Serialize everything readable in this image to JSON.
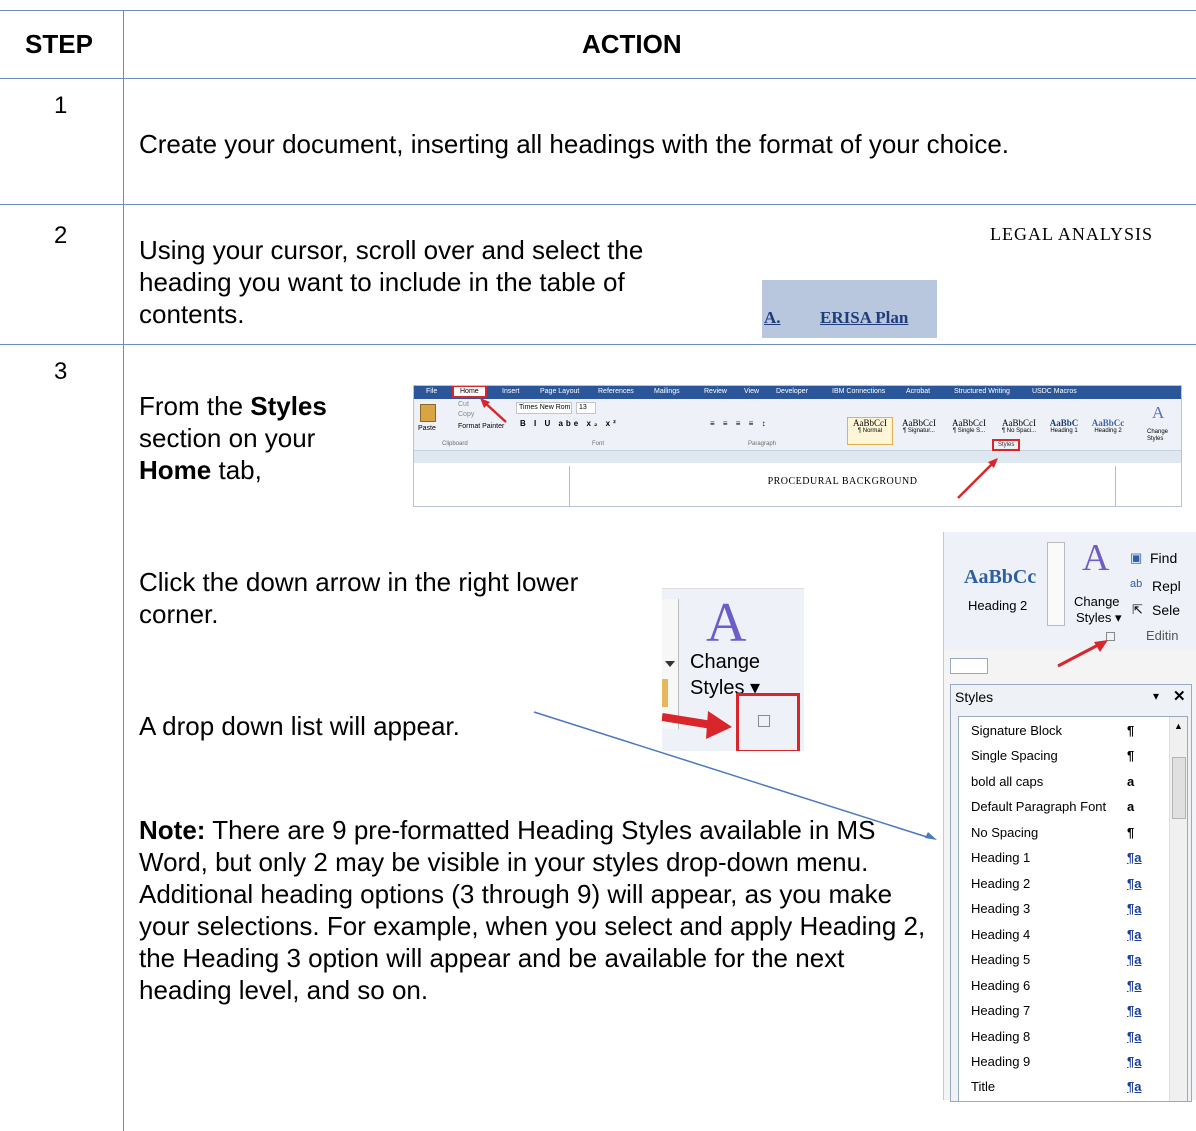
{
  "table": {
    "header_step": "STEP",
    "header_action": "ACTION",
    "row1": {
      "step": "1",
      "text": "Create your document, inserting all headings with the format of your choice."
    },
    "row2": {
      "step": "2",
      "text": "Using your cursor, scroll over and select the heading you want to include in the table of contents.",
      "sample_heading": "LEGAL ANALYSIS",
      "sample_label": "A.",
      "sample_title": "ERISA Plan"
    },
    "row3": {
      "step": "3",
      "from_the": "From the ",
      "styles_word": "Styles",
      "section_on": " section on your ",
      "home_word": "Home",
      "tab_text": " tab,",
      "click_text": "Click the down arrow in the right lower corner.",
      "dropdown_text": "A drop down list will appear.",
      "note_label": "Note:",
      "note_text": "  There are 9 pre-formatted Heading Styles available in MS Word, but only 2 may be visible in your styles drop-down menu.  Additional heading options (3 through 9) will appear, as you make your selections.  For example, when you select and apply Heading 2, the Heading 3 option will appear and be available for the next heading level, and so on."
    }
  },
  "ribbon": {
    "tabs": [
      "File",
      "Home",
      "Insert",
      "Page Layout",
      "References",
      "Mailings",
      "Review",
      "View",
      "Developer",
      "IBM Connections",
      "Acrobat",
      "Structured Writing",
      "USDC Macros"
    ],
    "clipboard": {
      "paste": "Paste",
      "cut": "Cut",
      "copy": "Copy",
      "format_painter": "Format Painter",
      "group": "Clipboard"
    },
    "font": {
      "name": "Times New Rom",
      "size": "13",
      "group": "Font"
    },
    "paragraph_group": "Paragraph",
    "styles_group": "Styles",
    "style_samples": [
      {
        "sample": "AaBbCcI",
        "name": "¶ Normal"
      },
      {
        "sample": "AaBbCcI",
        "name": "¶ Signatur..."
      },
      {
        "sample": "AaBbCcI",
        "name": "¶ Single S..."
      },
      {
        "sample": "AaBbCcI",
        "name": "¶ No Spaci..."
      },
      {
        "sample": "AaBbC",
        "name": "Heading 1"
      },
      {
        "sample": "AaBbCc",
        "name": "Heading 2"
      }
    ],
    "change_styles": "Change Styles",
    "document_text": "PROCEDURAL BACKGROUND"
  },
  "zoom": {
    "change": "Change",
    "styles": "Styles"
  },
  "pane": {
    "heading2_sample": "AaBbCc",
    "heading2_label": "Heading 2",
    "change": "Change",
    "styles": "Styles",
    "find": "Find",
    "replace": "Repl",
    "select": "Sele",
    "editing": "Editin",
    "panel_title": "Styles",
    "items": [
      {
        "name": "Signature Block",
        "icon": "¶"
      },
      {
        "name": "Single Spacing",
        "icon": "¶"
      },
      {
        "name": "bold all caps",
        "icon": "a"
      },
      {
        "name": "Default Paragraph Font",
        "icon": "a"
      },
      {
        "name": "No Spacing",
        "icon": "¶"
      },
      {
        "name": "Heading 1",
        "icon": "¶a"
      },
      {
        "name": "Heading 2",
        "icon": "¶a"
      },
      {
        "name": "Heading 3",
        "icon": "¶a"
      },
      {
        "name": "Heading 4",
        "icon": "¶a"
      },
      {
        "name": "Heading 5",
        "icon": "¶a"
      },
      {
        "name": "Heading 6",
        "icon": "¶a"
      },
      {
        "name": "Heading 7",
        "icon": "¶a"
      },
      {
        "name": "Heading 8",
        "icon": "¶a"
      },
      {
        "name": "Heading 9",
        "icon": "¶a"
      },
      {
        "name": "Title",
        "icon": "¶a"
      }
    ]
  },
  "colors": {
    "table_border": "#6c8ebf",
    "highlight_red": "#d9262b",
    "heading_blue": "#1f3d7a",
    "selection_blue": "#b8c6de"
  }
}
